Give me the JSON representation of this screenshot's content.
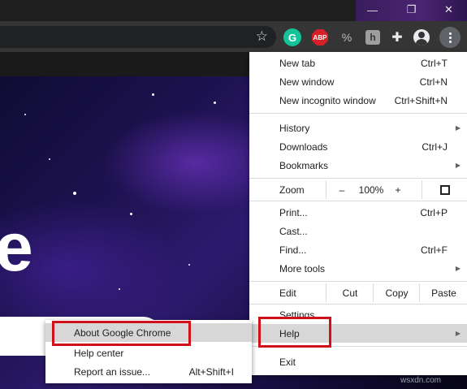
{
  "window": {
    "minimize_glyph": "—",
    "restore_glyph": "❐",
    "close_glyph": "✕"
  },
  "toolbar": {
    "star_glyph": "☆",
    "extensions": {
      "grammarly": "G",
      "adblock": "ABP",
      "third": "%",
      "fourth": "h",
      "puzzle": "✚"
    }
  },
  "page": {
    "big_letter": "e"
  },
  "menu": {
    "new_tab": {
      "label": "New tab",
      "shortcut": "Ctrl+T"
    },
    "new_window": {
      "label": "New window",
      "shortcut": "Ctrl+N"
    },
    "new_incognito": {
      "label": "New incognito window",
      "shortcut": "Ctrl+Shift+N"
    },
    "history": {
      "label": "History"
    },
    "downloads": {
      "label": "Downloads",
      "shortcut": "Ctrl+J"
    },
    "bookmarks": {
      "label": "Bookmarks"
    },
    "zoom": {
      "label": "Zoom",
      "minus": "–",
      "level": "100%",
      "plus": "+"
    },
    "print": {
      "label": "Print...",
      "shortcut": "Ctrl+P"
    },
    "cast": {
      "label": "Cast..."
    },
    "find": {
      "label": "Find...",
      "shortcut": "Ctrl+F"
    },
    "more_tools": {
      "label": "More tools"
    },
    "edit": {
      "label": "Edit",
      "cut": "Cut",
      "copy": "Copy",
      "paste": "Paste"
    },
    "settings": {
      "label": "Settings"
    },
    "help": {
      "label": "Help"
    },
    "exit": {
      "label": "Exit"
    },
    "submenu_arrow": "▶"
  },
  "help_submenu": {
    "about": {
      "label": "About Google Chrome"
    },
    "help_center": {
      "label": "Help center"
    },
    "report": {
      "label": "Report an issue...",
      "shortcut": "Alt+Shift+I"
    }
  },
  "watermark": "wsxdn.com",
  "colors": {
    "highlight_box": "#d0111b",
    "menu_hover": "#d7d7d7"
  }
}
